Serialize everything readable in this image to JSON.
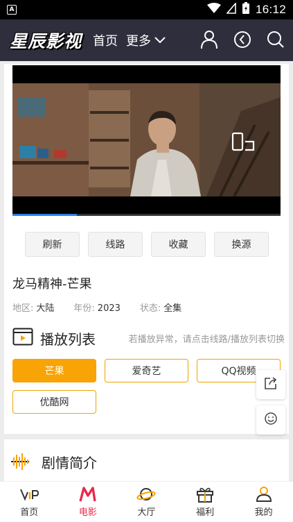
{
  "status_bar": {
    "notification_badge": "A",
    "time": "16:12"
  },
  "header": {
    "logo": "星辰影视",
    "nav": [
      {
        "label": "首页"
      },
      {
        "label": "更多"
      }
    ],
    "icons": [
      "user-icon",
      "history-icon",
      "search-icon"
    ]
  },
  "player": {
    "progress": 0.24,
    "rotate_icon": "rotate-screen-icon"
  },
  "actions": [
    {
      "label": "刷新"
    },
    {
      "label": "线路"
    },
    {
      "label": "收藏"
    },
    {
      "label": "换源"
    }
  ],
  "movie": {
    "title": "龙马精神-芒果",
    "region_label": "地区:",
    "region": "大陆",
    "year_label": "年份:",
    "year": "2023",
    "status_label": "状态:",
    "status": "全集"
  },
  "playlist": {
    "title": "播放列表",
    "tip": "若播放异常，请点击线路/播放列表切换",
    "sources": [
      {
        "label": "芒果",
        "active": true
      },
      {
        "label": "爱奇艺",
        "active": false
      },
      {
        "label": "QQ视频",
        "active": false
      },
      {
        "label": "优酷网",
        "active": false
      }
    ]
  },
  "floating": [
    "share-icon",
    "smile-icon",
    "comment-icon"
  ],
  "synopsis": {
    "title": "剧情简介"
  },
  "bottom_nav": [
    {
      "label": "首页",
      "icon": "vip-icon",
      "active": false
    },
    {
      "label": "电影",
      "icon": "movie-m-icon",
      "active": true
    },
    {
      "label": "大厅",
      "icon": "planet-icon",
      "active": false
    },
    {
      "label": "福利",
      "icon": "gift-icon",
      "active": false
    },
    {
      "label": "我的",
      "icon": "profile-icon",
      "active": false
    }
  ],
  "colors": {
    "accent": "#f8a306",
    "header_bg": "#2f2e3d",
    "active_nav": "#e8294a",
    "progress": "#2a7de1"
  }
}
